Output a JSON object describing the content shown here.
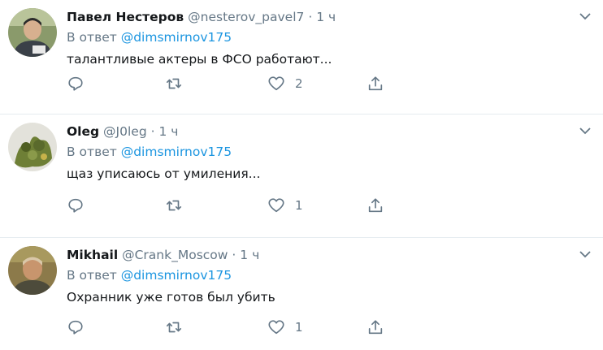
{
  "tweets": [
    {
      "name": "Павел Нестеров",
      "handle": "@nesterov_pavel7",
      "time": "1 ч",
      "reply_prefix": "В ответ",
      "reply_to": "@dimsmirnov175",
      "text": "талантливые актеры в ФСО работают...",
      "likes": "2",
      "avatar_colors": {
        "bg": "#8a9a6b",
        "face": "#d7b08f",
        "shirt": "#3a4048"
      }
    },
    {
      "name": "Oleg",
      "handle": "@J0leg",
      "time": "1 ч",
      "reply_prefix": "В ответ",
      "reply_to": "@dimsmirnov175",
      "text": "щаз уписаюсь от умиления...",
      "likes": "1",
      "avatar_colors": {
        "bg": "#e3e2db",
        "face": "#5a6a2c",
        "shirt": "#6e7f36"
      }
    },
    {
      "name": "Mikhail",
      "handle": "@Crank_Moscow",
      "time": "1 ч",
      "reply_prefix": "В ответ",
      "reply_to": "@dimsmirnov175",
      "text": "Охранник уже готов был убить",
      "likes": "1",
      "avatar_colors": {
        "bg": "#8c7a4a",
        "face": "#c8956d",
        "shirt": "#4d4b3b"
      }
    }
  ],
  "icons": {
    "reply": "reply-icon",
    "retweet": "retweet-icon",
    "like": "heart-icon",
    "share": "share-icon",
    "menu": "chevron-down-icon"
  },
  "colors": {
    "link": "#1b95e0",
    "secondary_text": "#657786",
    "divider": "#e6ecf0"
  }
}
